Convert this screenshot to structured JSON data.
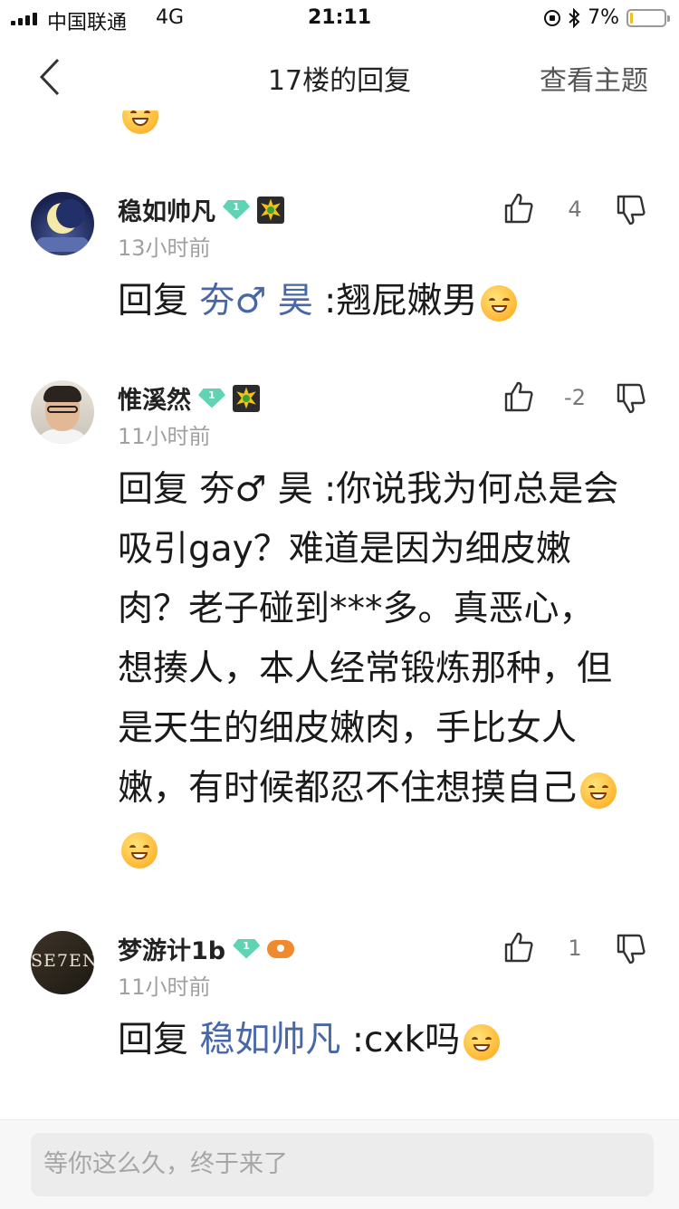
{
  "status_bar": {
    "carrier": "中国联通",
    "network": "4G",
    "time": "21:11",
    "battery": "7%"
  },
  "nav": {
    "title": "17楼的回复",
    "right_label": "查看主题"
  },
  "comments": [
    {
      "username": "稳如帅凡",
      "level": "1",
      "time": "13小时前",
      "likes": "4",
      "reply_prefix": "回复 ",
      "mention": "夯♂ 昊",
      "text": " :翘屁嫩男"
    },
    {
      "username": "惟溪然",
      "level": "1",
      "time": "11小时前",
      "likes": "-2",
      "reply_prefix": "回复 ",
      "mention": "",
      "text": "夯♂ 昊 :你说我为何总是会吸引gay？难道是因为细皮嫩肉？老子碰到***多。真恶心，想揍人，本人经常锻炼那种，但是天生的细皮嫩肉，手比女人嫩，有时候都忍不住想摸自己"
    },
    {
      "username": "梦游计1b",
      "level": "1",
      "time": "11小时前",
      "likes": "1",
      "reply_prefix": "回复 ",
      "mention": "稳如帅凡",
      "text": " :cxk吗",
      "avatar_text": "SE7EN"
    }
  ],
  "input": {
    "placeholder": "等你这么久，终于来了"
  },
  "colors": {
    "mention": "#4867a8",
    "level_badge": "#5fd3b4",
    "muted": "#a0a0a0"
  }
}
